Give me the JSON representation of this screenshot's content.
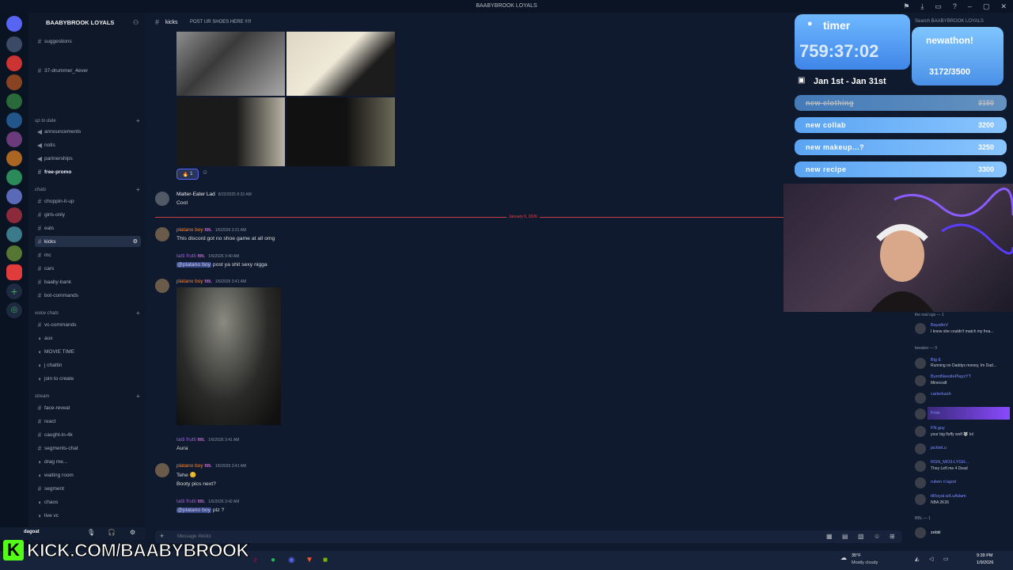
{
  "window": {
    "title": "BAABYBROOK LOYALS"
  },
  "sidebar": {
    "server_name": "BAABYBROOK LOYALS",
    "items": [
      {
        "label": "suggestions",
        "kind": "text"
      },
      {
        "label": "37-drummer_4ever",
        "kind": "text"
      },
      {
        "label": "announcements",
        "kind": "announce"
      },
      {
        "label": "notis",
        "kind": "announce"
      },
      {
        "label": "partnerships",
        "kind": "announce"
      },
      {
        "label": "free-promo",
        "kind": "text"
      },
      {
        "label": "choppin-it-up",
        "kind": "text"
      },
      {
        "label": "girls-only",
        "kind": "text"
      },
      {
        "label": "eats",
        "kind": "text"
      },
      {
        "label": "kicks",
        "kind": "text"
      },
      {
        "label": "mc",
        "kind": "text"
      },
      {
        "label": "cars",
        "kind": "text"
      },
      {
        "label": "baaby-bank",
        "kind": "text"
      },
      {
        "label": "bot-commands",
        "kind": "text"
      },
      {
        "label": "vc-commands",
        "kind": "text"
      },
      {
        "label": "aux",
        "kind": "voice"
      },
      {
        "label": "MOVIE TIME",
        "kind": "voice"
      },
      {
        "label": "j chattin",
        "kind": "voice"
      },
      {
        "label": "join to create",
        "kind": "voice"
      },
      {
        "label": "face-reveal",
        "kind": "text"
      },
      {
        "label": "react",
        "kind": "text"
      },
      {
        "label": "caught-in-4k",
        "kind": "text"
      },
      {
        "label": "segments-chat",
        "kind": "text"
      },
      {
        "label": "drag me...",
        "kind": "voice"
      },
      {
        "label": "waiting room",
        "kind": "voice"
      },
      {
        "label": "segment",
        "kind": "text"
      },
      {
        "label": "chaos",
        "kind": "voice"
      },
      {
        "label": "live vc",
        "kind": "voice"
      }
    ],
    "categories": [
      "up to date",
      "chats",
      "voice chats",
      "stream"
    ],
    "user": {
      "name": "dagoat"
    }
  },
  "header": {
    "channel": "kicks",
    "topic": "POST UR SHOES HERE !!!!!"
  },
  "messages": [
    {
      "author": "Matter-Eater Lad",
      "time": "8/22/2025 8:32 AM",
      "text": "Cool",
      "color": "#f2f3f5"
    },
    {
      "author": "platano boy",
      "tag": "BBL",
      "time": "1/6/2026 3:31 AM",
      "text": "This discord got no shoe game at all omg",
      "color": "#f0883e"
    },
    {
      "author": "tatti frutti",
      "tag": "BBL",
      "time": "1/6/2026 3:40 AM",
      "mention": "@platano boy",
      "text": " post ya shit sexy nigga",
      "color": "#a25bd6"
    },
    {
      "author": "platano boy",
      "tag": "BBL",
      "time": "1/6/2026 3:41 AM",
      "text": "",
      "color": "#f0883e"
    },
    {
      "author": "tatti frutti",
      "tag": "BBL",
      "time": "1/6/2026 3:41 AM",
      "text": "Aura",
      "color": "#a25bd6"
    },
    {
      "author": "platano boy",
      "tag": "BBL",
      "time": "1/6/2026 3:41 AM",
      "text": "Tehe",
      "text2": "Booty pics next?",
      "color": "#f0883e"
    },
    {
      "author": "tatti frutti",
      "tag": "BBL",
      "time": "1/6/2026 3:42 AM",
      "mention": "@platano boy",
      "text": " plz ?",
      "color": "#a25bd6"
    }
  ],
  "reaction": {
    "emoji": "🔥",
    "count": "1"
  },
  "date_divider": "January 6, 2026",
  "composer": {
    "placeholder": "Message #kicks"
  },
  "overlay": {
    "timer_label": "timer",
    "timer_value": "759:37:02",
    "date_range": "Jan 1st - Jan 31st",
    "goal_title": "newathon!",
    "goal_progress": "3172/3500",
    "goals": [
      {
        "label": "new clothing",
        "value": "3150"
      },
      {
        "label": "new collab",
        "value": "3200"
      },
      {
        "label": "new makeup...?",
        "value": "3250"
      },
      {
        "label": "new recipe",
        "value": "3300"
      }
    ]
  },
  "stream_chat": {
    "headers": [
      "the real ogs — 1",
      "tweaker — 9",
      "BBL — 1"
    ],
    "entries": [
      {
        "user": "BayaltoV",
        "tag": "LDN",
        "msg": "I knew she couldn't match my frea..."
      },
      {
        "user": "Big E",
        "msg": "Running on Daddys money, Im Dad..."
      },
      {
        "user": "BurntNeedlePlayzYT",
        "msg": "Minecraft"
      },
      {
        "user": "carterkash",
        "tag": "BAU",
        "msg": ""
      },
      {
        "user": "Frisk",
        "tag": "GS",
        "msg": ""
      },
      {
        "user": "FN.guy",
        "msg": "your big fluffy wolf 🐺 lol"
      },
      {
        "user": "jackieLu",
        "tag": "ALGX",
        "msg": ""
      },
      {
        "user": "RGN_MO3-LYGH...",
        "tag": "CONK",
        "msg": "They Left me 4 Dead"
      },
      {
        "user": "ruben n'agod",
        "msg": ""
      },
      {
        "user": "ttRoyal.w/LuAdam",
        "msg": "NBA 2K26"
      },
      {
        "user": "zebiii",
        "msg": ""
      }
    ]
  },
  "taskbar": {
    "weather_temp": "35°F",
    "weather_desc": "Mostly cloudy",
    "time": "9:39 PM",
    "date": "1/9/2026"
  },
  "kick_banner": {
    "url": "KICK.COM/BAABYBROOK"
  }
}
